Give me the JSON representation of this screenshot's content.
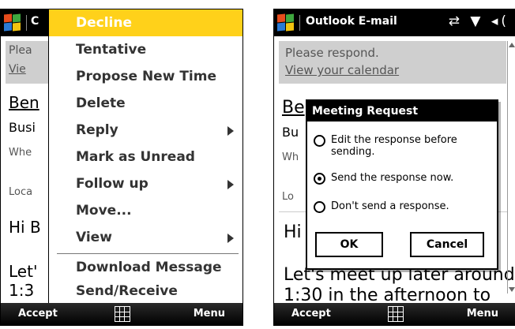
{
  "left_screen": {
    "title_fragment": "C",
    "menu_items": [
      {
        "label": "Decline",
        "selected": true,
        "submenu": false
      },
      {
        "label": "Tentative",
        "selected": false,
        "submenu": false
      },
      {
        "label": "Propose New Time",
        "selected": false,
        "submenu": false
      },
      {
        "label": "Delete",
        "selected": false,
        "submenu": false
      },
      {
        "label": "Reply",
        "selected": false,
        "submenu": true
      },
      {
        "label": "Mark as Unread",
        "selected": false,
        "submenu": false
      },
      {
        "label": "Follow up",
        "selected": false,
        "submenu": true
      },
      {
        "label": "Move...",
        "selected": false,
        "submenu": false
      },
      {
        "label": "View",
        "selected": false,
        "submenu": true
      },
      {
        "label": "Download Message",
        "selected": false,
        "submenu": false
      },
      {
        "label": "Send/Receive",
        "selected": false,
        "submenu": false
      }
    ],
    "background_fragments": [
      "Plea",
      "Vie",
      "Ben",
      "Busi",
      "Whe",
      "Loca",
      "Hi B",
      "Let'",
      "1:3"
    ],
    "softkeys": {
      "left": "Accept",
      "right": "Menu"
    }
  },
  "right_screen": {
    "app_title": "Outlook E-mail",
    "status_icons": "⇄ ▼ ◂(",
    "banner_line1": "Please respond.",
    "banner_line2": "View your calendar",
    "sender_fragment": "Be",
    "line_busy": "Bu",
    "line_when": "Wh",
    "line_location": "Lo",
    "body_line1": "Hi Ben,",
    "body_line2": "Let's meet up later around",
    "body_line3": "1:30 in the afternoon to",
    "dialog": {
      "title": "Meeting Request",
      "options": [
        {
          "label": "Edit the response before sending.",
          "selected": false
        },
        {
          "label": "Send the response now.",
          "selected": true
        },
        {
          "label": "Don't send a response.",
          "selected": false
        }
      ],
      "ok_label": "OK",
      "cancel_label": "Cancel"
    },
    "softkeys": {
      "left": "Accept",
      "right": "Menu"
    }
  },
  "colors": {
    "menu_highlight": "#ffd11a",
    "titlebar": "#000000",
    "banner": "#cfcfcf"
  }
}
